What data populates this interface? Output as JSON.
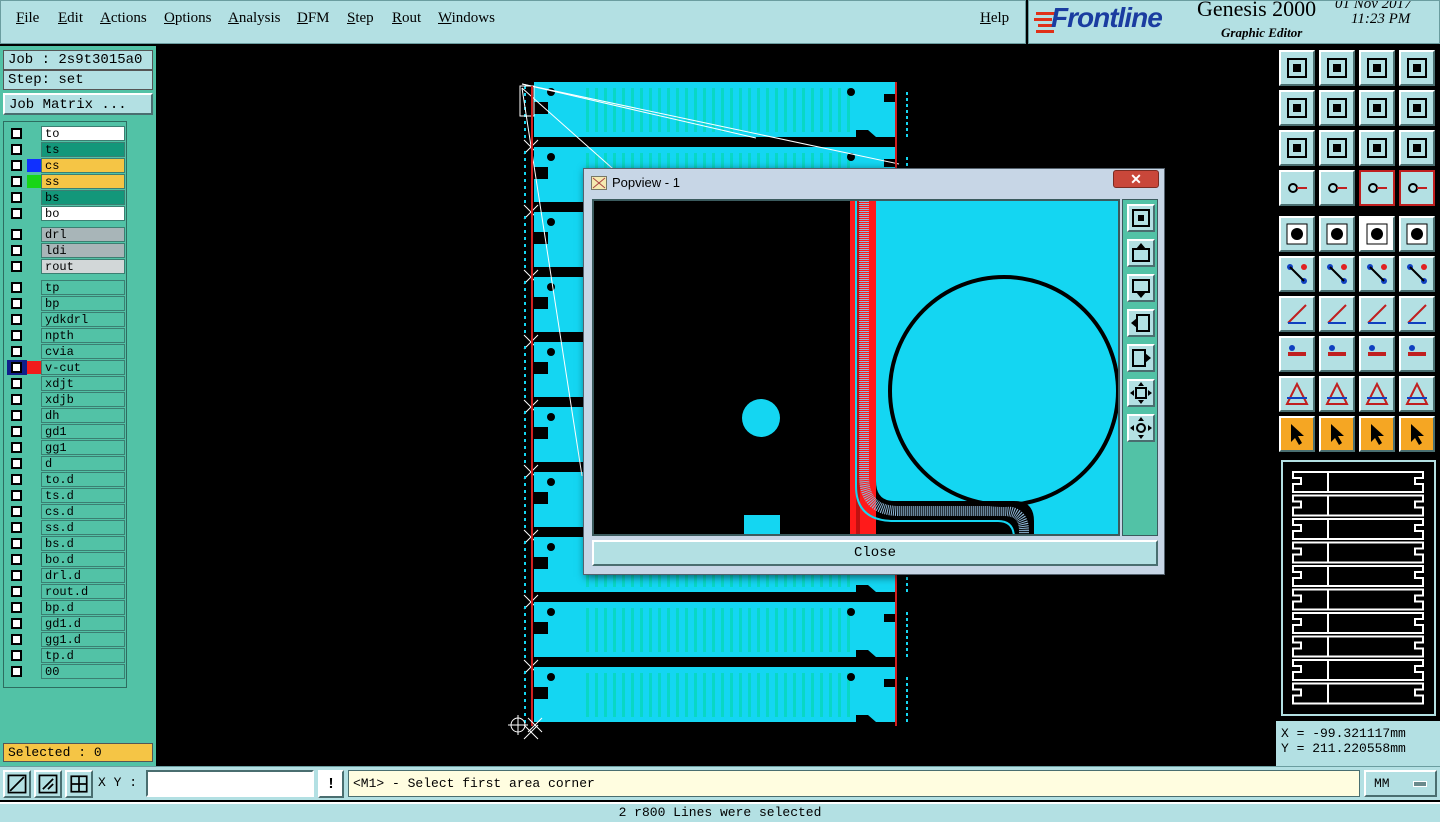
{
  "menu": [
    "File",
    "Edit",
    "Actions",
    "Options",
    "Analysis",
    "DFM",
    "Step",
    "Rout",
    "Windows"
  ],
  "help": "Help",
  "brand": {
    "logo": "Frontline",
    "app": "Genesis 2000",
    "subtitle": "Graphic Editor",
    "date": "01 Nov 2017",
    "time": "11:23 PM"
  },
  "job": {
    "job_label": "Job : 2s9t3015a0",
    "step_label": "Step: set",
    "matrix_button": "Job Matrix ..."
  },
  "layers_group1": [
    {
      "name": "to",
      "color": "#ffffff",
      "sw": ""
    },
    {
      "name": "ts",
      "color": "#13977a",
      "sw": ""
    },
    {
      "name": "cs",
      "color": "#f5c545",
      "sw": "#1030ff"
    },
    {
      "name": "ss",
      "color": "#f5c545",
      "sw": "#18d518"
    },
    {
      "name": "bs",
      "color": "#13977a",
      "sw": ""
    },
    {
      "name": "bo",
      "color": "#ffffff",
      "sw": ""
    }
  ],
  "layers_group2": [
    {
      "name": "drl",
      "color": "#a8b5b8",
      "sw": ""
    },
    {
      "name": "ldi",
      "color": "#a8b5b8",
      "sw": ""
    },
    {
      "name": "rout",
      "color": "#d2d7d8",
      "sw": ""
    }
  ],
  "layers_group3": [
    {
      "name": "tp",
      "color": "#52c2a6",
      "sw": ""
    },
    {
      "name": "bp",
      "color": "#52c2a6",
      "sw": ""
    },
    {
      "name": "ydkdrl",
      "color": "#52c2a6",
      "sw": ""
    },
    {
      "name": "npth",
      "color": "#52c2a6",
      "sw": ""
    },
    {
      "name": "cvia",
      "color": "#52c2a6",
      "sw": ""
    },
    {
      "name": "v-cut",
      "color": "#52c2a6",
      "sw": "#f21b1b"
    },
    {
      "name": "xdjt",
      "color": "#52c2a6",
      "sw": ""
    },
    {
      "name": "xdjb",
      "color": "#52c2a6",
      "sw": ""
    },
    {
      "name": "dh",
      "color": "#52c2a6",
      "sw": ""
    },
    {
      "name": "gd1",
      "color": "#52c2a6",
      "sw": ""
    },
    {
      "name": "gg1",
      "color": "#52c2a6",
      "sw": ""
    },
    {
      "name": "d",
      "color": "#52c2a6",
      "sw": ""
    },
    {
      "name": "to.d",
      "color": "#52c2a6",
      "sw": ""
    },
    {
      "name": "ts.d",
      "color": "#52c2a6",
      "sw": ""
    },
    {
      "name": "cs.d",
      "color": "#52c2a6",
      "sw": ""
    },
    {
      "name": "ss.d",
      "color": "#52c2a6",
      "sw": ""
    },
    {
      "name": "bs.d",
      "color": "#52c2a6",
      "sw": ""
    },
    {
      "name": "bo.d",
      "color": "#52c2a6",
      "sw": ""
    },
    {
      "name": "drl.d",
      "color": "#52c2a6",
      "sw": ""
    },
    {
      "name": "rout.d",
      "color": "#52c2a6",
      "sw": ""
    },
    {
      "name": "bp.d",
      "color": "#52c2a6",
      "sw": ""
    },
    {
      "name": "gd1.d",
      "color": "#52c2a6",
      "sw": ""
    },
    {
      "name": "gg1.d",
      "color": "#52c2a6",
      "sw": ""
    },
    {
      "name": "tp.d",
      "color": "#52c2a6",
      "sw": ""
    },
    {
      "name": "00",
      "color": "#52c2a6",
      "sw": ""
    }
  ],
  "selected": "Selected : 0",
  "popup": {
    "title": "Popview - 1",
    "close_label": "Close"
  },
  "coords": {
    "x": "X = -99.321117mm",
    "y": "Y = 211.220558mm"
  },
  "bottom": {
    "xy_label": "X Y :",
    "xy_value": "",
    "prompt": "<M1> - Select first area corner",
    "units": "MM"
  },
  "status": "2 r800 Lines were selected"
}
